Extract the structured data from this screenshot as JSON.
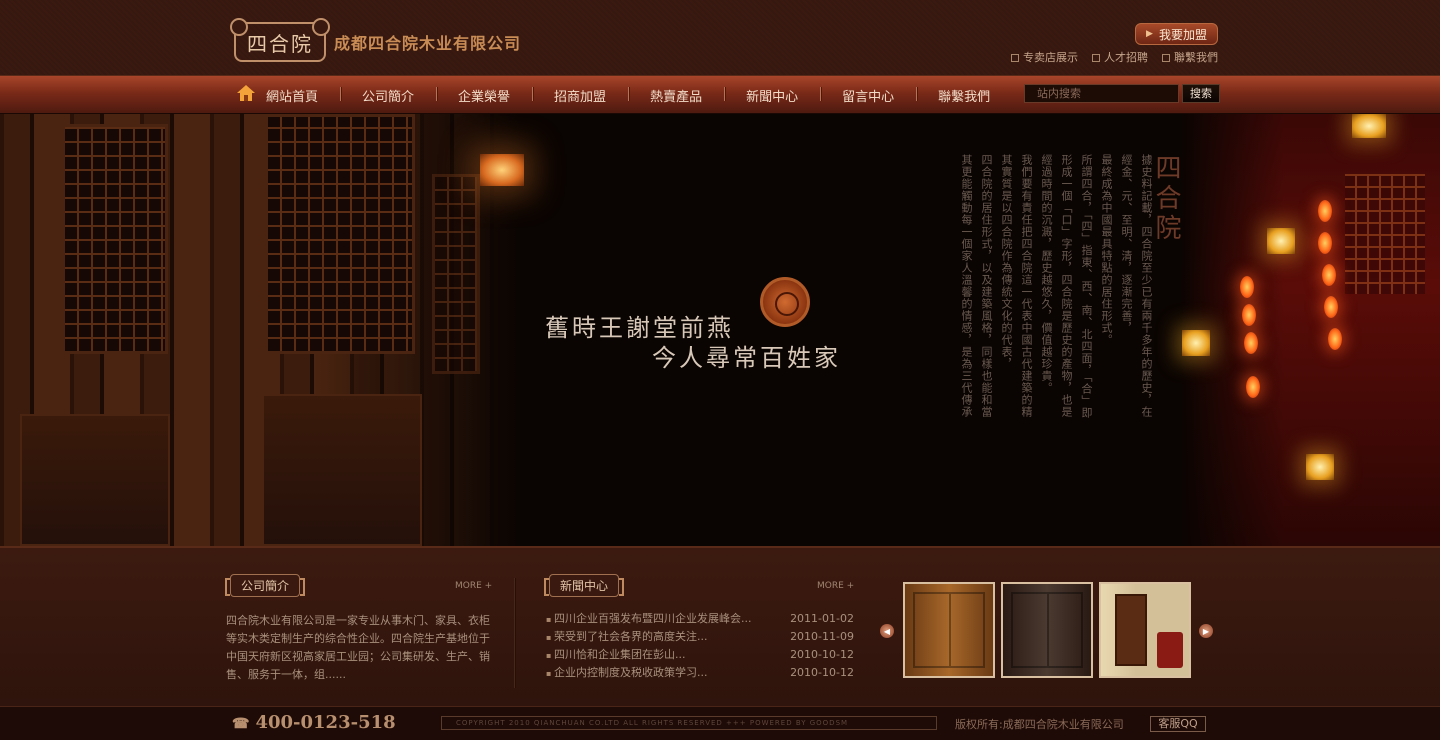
{
  "header": {
    "logo_text": "四合院",
    "company_name": "成都四合院木业有限公司",
    "join_button": "我要加盟",
    "top_links": [
      "专卖店展示",
      "人才招聘",
      "聯繫我們"
    ]
  },
  "nav": {
    "items": [
      "網站首頁",
      "公司簡介",
      "企業榮譽",
      "招商加盟",
      "熱賣產品",
      "新聞中心",
      "留言中心",
      "聯繫我們"
    ],
    "search_placeholder": "站内搜索",
    "search_button": "搜索"
  },
  "banner": {
    "poem_line1": "舊時王謝堂前燕",
    "poem_line2": "今人尋常百姓家",
    "vertical_title": "四合院",
    "vertical_text": [
      "據史料記載，四合院至少已有兩千多年的歷史，在遼代已初具規模，",
      "經金、元、至明、清，逐漸完善，",
      "最終成為中國最具特點的居住形式。",
      "所謂四合，「四」指東、西、南、北四面，「合」即四面房屋圍在一起，",
      "形成一個「口」字形，四合院是歷史的產物，也是中國古老且最大的合院。",
      "經過時間的沉澱，歷史越悠久，價值越珍貴。",
      "我們要有責任把四合院這一代表中國古代建築的精品繼承下去，",
      "其實質是以四合院作為傳統文化的代表，",
      "四合院的居住形式，以及建築風格，同樣也能和當今",
      "其更能觸動每一個家人溫馨的情感，是為三代傳承的居住方式，其精髓就是和睦。"
    ]
  },
  "about": {
    "title": "公司簡介",
    "more": "MORE +",
    "text": "四合院木业有限公司是一家专业从事木门、家具、衣柜等实木类定制生产的综合性企业。四合院生产基地位于中国天府新区视高家居工业园；公司集研发、生产、销售、服务于一体，组......"
  },
  "news": {
    "title": "新聞中心",
    "more": "MORE +",
    "items": [
      {
        "title": "四川企业百强发布暨四川企业发展峰会...",
        "date": "2011-01-02"
      },
      {
        "title": "荣受到了社会各界的高度关注...",
        "date": "2010-11-09"
      },
      {
        "title": "四川恰和企业集团在彭山...",
        "date": "2010-10-12"
      },
      {
        "title": "企业内控制度及税收政策学习...",
        "date": "2010-10-12"
      }
    ]
  },
  "footer": {
    "phone": "400-0123-518",
    "copyright": "COPYRIGHT  2010 QIANCHUAN CO.LTD ALL RIGHTS RESERVED        +++ POWERED BY GOODSM",
    "company": "版权所有:成都四合院木业有限公司",
    "qq_button": "客服QQ"
  },
  "colors": {
    "nav_gradient_top": "#a8452a",
    "accent_text": "#c98c55",
    "background": "#2a120a"
  }
}
